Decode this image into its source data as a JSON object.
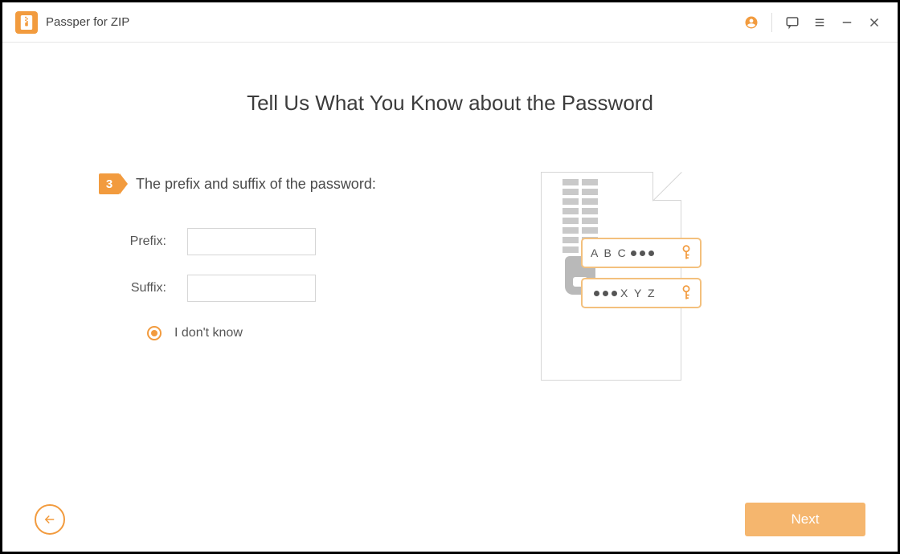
{
  "app": {
    "title": "Passper for ZIP"
  },
  "titlebar": {
    "user_icon": "user",
    "chat_icon": "chat",
    "menu_icon": "menu",
    "minimize_icon": "minimize",
    "close_icon": "close"
  },
  "heading": "Tell Us What You Know about the Password",
  "step": {
    "number": "3",
    "text": "The prefix and suffix of the password:"
  },
  "fields": {
    "prefix": {
      "label": "Prefix:",
      "value": ""
    },
    "suffix": {
      "label": "Suffix:",
      "value": ""
    }
  },
  "options": {
    "dont_know": {
      "label": "I don't know",
      "selected": true
    }
  },
  "illustration": {
    "sample_prefix": "A B C",
    "sample_suffix": "X Y Z"
  },
  "footer": {
    "next_label": "Next"
  },
  "colors": {
    "accent": "#f29b3e"
  }
}
